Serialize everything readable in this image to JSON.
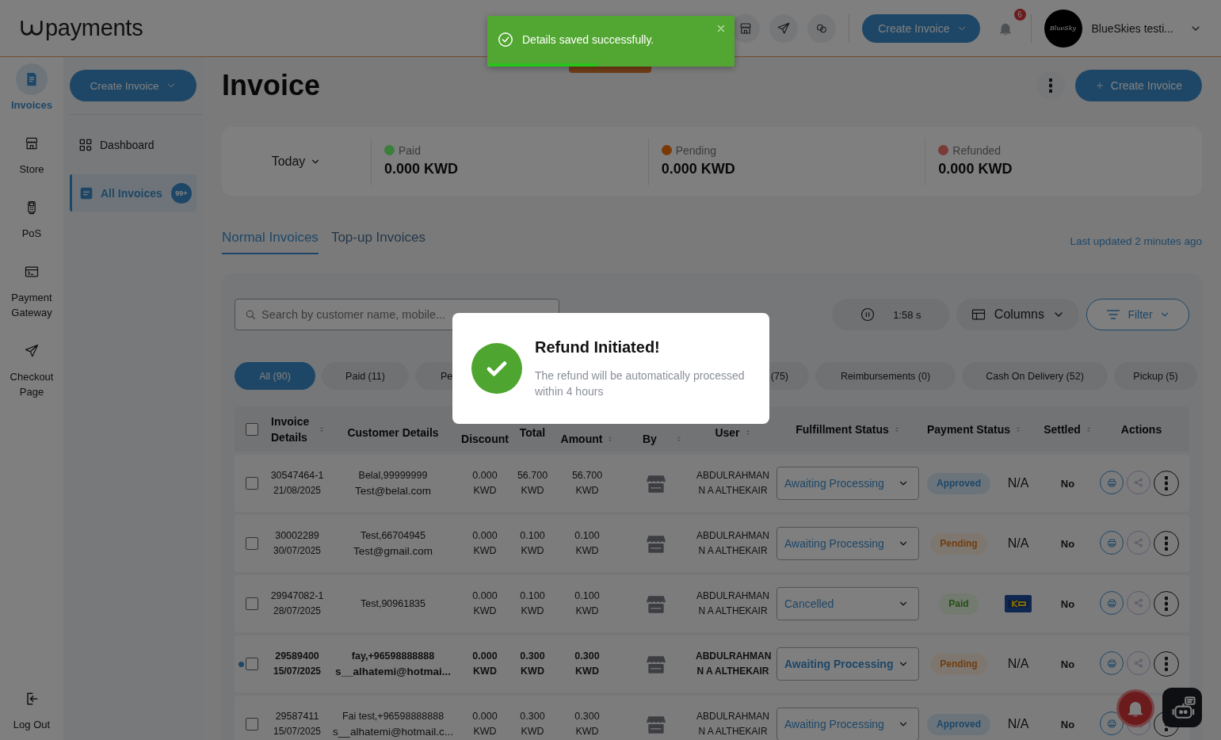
{
  "header": {
    "brand": "payments",
    "create_button": "Create Invoice",
    "notification_count": "6",
    "account": {
      "avatar_text": "BlueSky",
      "name": "BlueSkies testi..."
    }
  },
  "toast": {
    "message": "Details saved successfully.",
    "level": 0.44
  },
  "rail": {
    "items": [
      {
        "label": "Invoices",
        "selected": true
      },
      {
        "label": "Store",
        "selected": false
      },
      {
        "label": "PoS",
        "selected": false
      },
      {
        "label": "Payment Gateway",
        "selected": false
      },
      {
        "label": "Checkout Page",
        "selected": false
      }
    ],
    "logout": "Log Out"
  },
  "subnav": {
    "create_button": "Create Invoice",
    "items": [
      {
        "label": "Dashboard",
        "selected": false
      },
      {
        "label": "All Invoices",
        "selected": true,
        "badge": "99+"
      }
    ]
  },
  "page": {
    "title": "Invoice",
    "create_button": "Create Invoice"
  },
  "summary": {
    "period": "Today",
    "stats": [
      {
        "label": "Paid",
        "value": "0.000 KWD",
        "color": "#3a7f3a"
      },
      {
        "label": "Pending",
        "value": "0.000 KWD",
        "color": "#7a3a06"
      },
      {
        "label": "Refunded",
        "value": "0.000 KWD",
        "color": "#7a3a36"
      }
    ]
  },
  "tabs": [
    {
      "label": "Normal Invoices",
      "selected": true
    },
    {
      "label": "Top-up Invoices",
      "selected": false
    }
  ],
  "last_updated": "Last updated 2 minutes ago",
  "toolbar": {
    "search": {
      "placeholder": "Search by customer name, mobile..."
    },
    "timer": "1:58 s",
    "columns_button": "Columns",
    "filter_button": "Filter"
  },
  "chips": [
    {
      "label": "All (90)",
      "selected": true
    },
    {
      "label": "Paid (11)",
      "selected": false
    },
    {
      "label": "Pe",
      "selected": false
    },
    {
      "label": "(75)",
      "selected": false
    },
    {
      "label": "Reimbursements (0)",
      "selected": false
    },
    {
      "label": "Cash On Delivery (52)",
      "selected": false
    },
    {
      "label": "Pickup (5)",
      "selected": false
    }
  ],
  "table": {
    "header_checked": false,
    "columns": [
      {
        "label": "Invoice Details",
        "sortable": true
      },
      {
        "label": "Customer Details",
        "sortable": false
      },
      {
        "label": "Discount",
        "sortable": false
      },
      {
        "label": "Total",
        "sortable": false
      },
      {
        "label": "Amount",
        "sortable": true
      },
      {
        "label": "By",
        "sortable": true
      },
      {
        "label": "User",
        "sortable": true
      },
      {
        "label": "Fulfillment Status",
        "sortable": true
      },
      {
        "label": "Payment Status",
        "sortable": true
      },
      {
        "label": "Settled",
        "sortable": true
      },
      {
        "label": "Actions",
        "sortable": false
      }
    ],
    "rows": [
      {
        "unread": false,
        "checked": false,
        "invoice_no": "30547464-1",
        "date": "21/08/2025",
        "customer": "Belal,99999999",
        "email": "Test@belal.com",
        "discount": "0.000 KWD",
        "total": "56.700 KWD",
        "amount": "56.700 KWD",
        "user": "ABDULRAHMAN N A ALTHEKAIR",
        "fulfillment": "Awaiting Processing",
        "payment_status": {
          "label": "Approved",
          "kind": "approved"
        },
        "settlement": {
          "kind": "text",
          "label": "N/A"
        },
        "settled": "No"
      },
      {
        "unread": false,
        "checked": false,
        "invoice_no": "30002289",
        "date": "30/07/2025",
        "customer": "Test,66704945",
        "email": "Test@gmail.com",
        "discount": "0.000 KWD",
        "total": "0.100 KWD",
        "amount": "0.100 KWD",
        "user": "ABDULRAHMAN N A ALTHEKAIR",
        "fulfillment": "Awaiting Processing",
        "payment_status": {
          "label": "Pending",
          "kind": "pending"
        },
        "settlement": {
          "kind": "text",
          "label": "N/A"
        },
        "settled": "No"
      },
      {
        "unread": false,
        "checked": false,
        "invoice_no": "29947082-1",
        "date": "28/07/2025",
        "customer": "Test,90961835",
        "discount": "0.000 KWD",
        "total": "0.100 KWD",
        "amount": "0.100 KWD",
        "user": "ABDULRAHMAN N A ALTHEKAIR",
        "fulfillment": "Cancelled",
        "payment_status": {
          "label": "Paid",
          "kind": "paid"
        },
        "settlement": {
          "kind": "logo"
        },
        "settled": "No"
      },
      {
        "unread": true,
        "checked": false,
        "invoice_no": "29589400",
        "date": "15/07/2025",
        "customer": "fay,+96598888888",
        "email": "s__alhatemi@hotmai...",
        "discount": "0.000 KWD",
        "total": "0.300 KWD",
        "amount": "0.300 KWD",
        "user": "ABDULRAHMAN N A ALTHEKAIR",
        "fulfillment": "Awaiting Processing",
        "payment_status": {
          "label": "Pending",
          "kind": "pending"
        },
        "settlement": {
          "kind": "text",
          "label": "N/A"
        },
        "settled": "No"
      },
      {
        "unread": false,
        "checked": false,
        "invoice_no": "29587411",
        "date": "15/07/2025",
        "customer": "Fai test,+96598888888",
        "email": "s__alhatemi@hotmail.c...",
        "discount": "0.000 KWD",
        "total": "0.300 KWD",
        "amount": "0.300 KWD",
        "user": "ABDULRAHMAN N A ALTHEKAIR",
        "fulfillment": "Awaiting Processing",
        "payment_status": {
          "label": "Approved",
          "kind": "approved"
        },
        "settlement": {
          "kind": "text",
          "label": "N/A"
        },
        "settled": "No"
      }
    ]
  },
  "modal": {
    "title": "Refund Initiated!",
    "message": "The refund will be automatically processed within 4 hours"
  }
}
